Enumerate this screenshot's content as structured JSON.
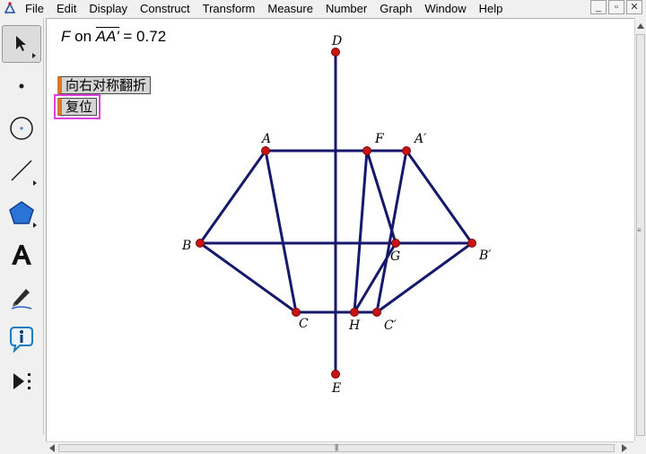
{
  "menubar": {
    "items": [
      "File",
      "Edit",
      "Display",
      "Construct",
      "Transform",
      "Measure",
      "Number",
      "Graph",
      "Window",
      "Help"
    ]
  },
  "window_controls": {
    "minimize": "_",
    "restore": "▫",
    "close": "✕"
  },
  "toolbox": {
    "tools": [
      "arrow-select-tool",
      "point-tool",
      "compass-tool",
      "straightedge-tool",
      "polygon-tool",
      "text-tool",
      "marker-tool",
      "information-tool",
      "custom-tool"
    ]
  },
  "canvas": {
    "measurement": {
      "point": "F",
      "on_word": " on ",
      "segment": "AA'",
      "equals": " = 0.72"
    },
    "buttons": {
      "flip_label": "向右对称翻折",
      "reset_label": "复位"
    }
  },
  "geometry": {
    "line_color": "#16186b",
    "point_color": "#c81414",
    "points": {
      "D": "D",
      "E": "E",
      "A": "A",
      "F": "F",
      "A2": "A′",
      "B": "B",
      "G": "G",
      "B2": "B′",
      "C": "C",
      "H": "H",
      "C2": "C′"
    }
  }
}
